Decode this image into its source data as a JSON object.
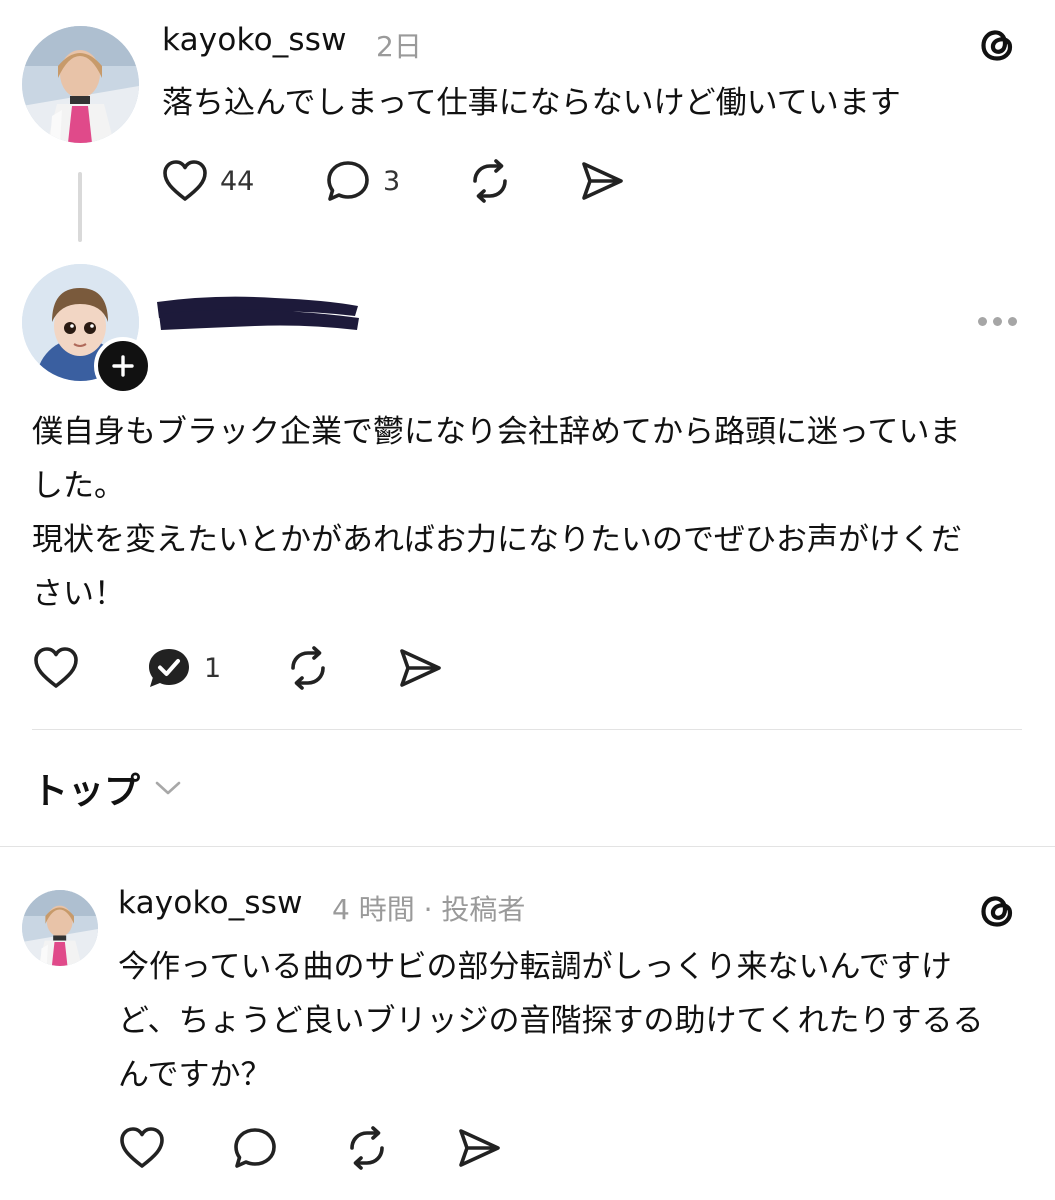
{
  "post": {
    "username": "kayoko_ssw",
    "time": "2日",
    "text": "落ち込んでしまって仕事にならないけど働いています",
    "likes": "44",
    "replies": "3"
  },
  "reply": {
    "lines": [
      "僕自身もブラック企業で鬱になり会社辞めてから路頭に迷っていま",
      "した。",
      "現状を変えたいとかがあればお力になりたいのでぜひお声がけくだ",
      "さい！"
    ],
    "replies": "1"
  },
  "sort": {
    "label": "トップ"
  },
  "author_reply": {
    "username": "kayoko_ssw",
    "meta": "4 時間 · 投稿者",
    "lines": [
      "今作っている曲のサビの部分転調がしっくり来ないんですけ",
      "ど、ちょうど良いブリッジの音階探すの助けてくれたりするる",
      "んですか？"
    ]
  }
}
